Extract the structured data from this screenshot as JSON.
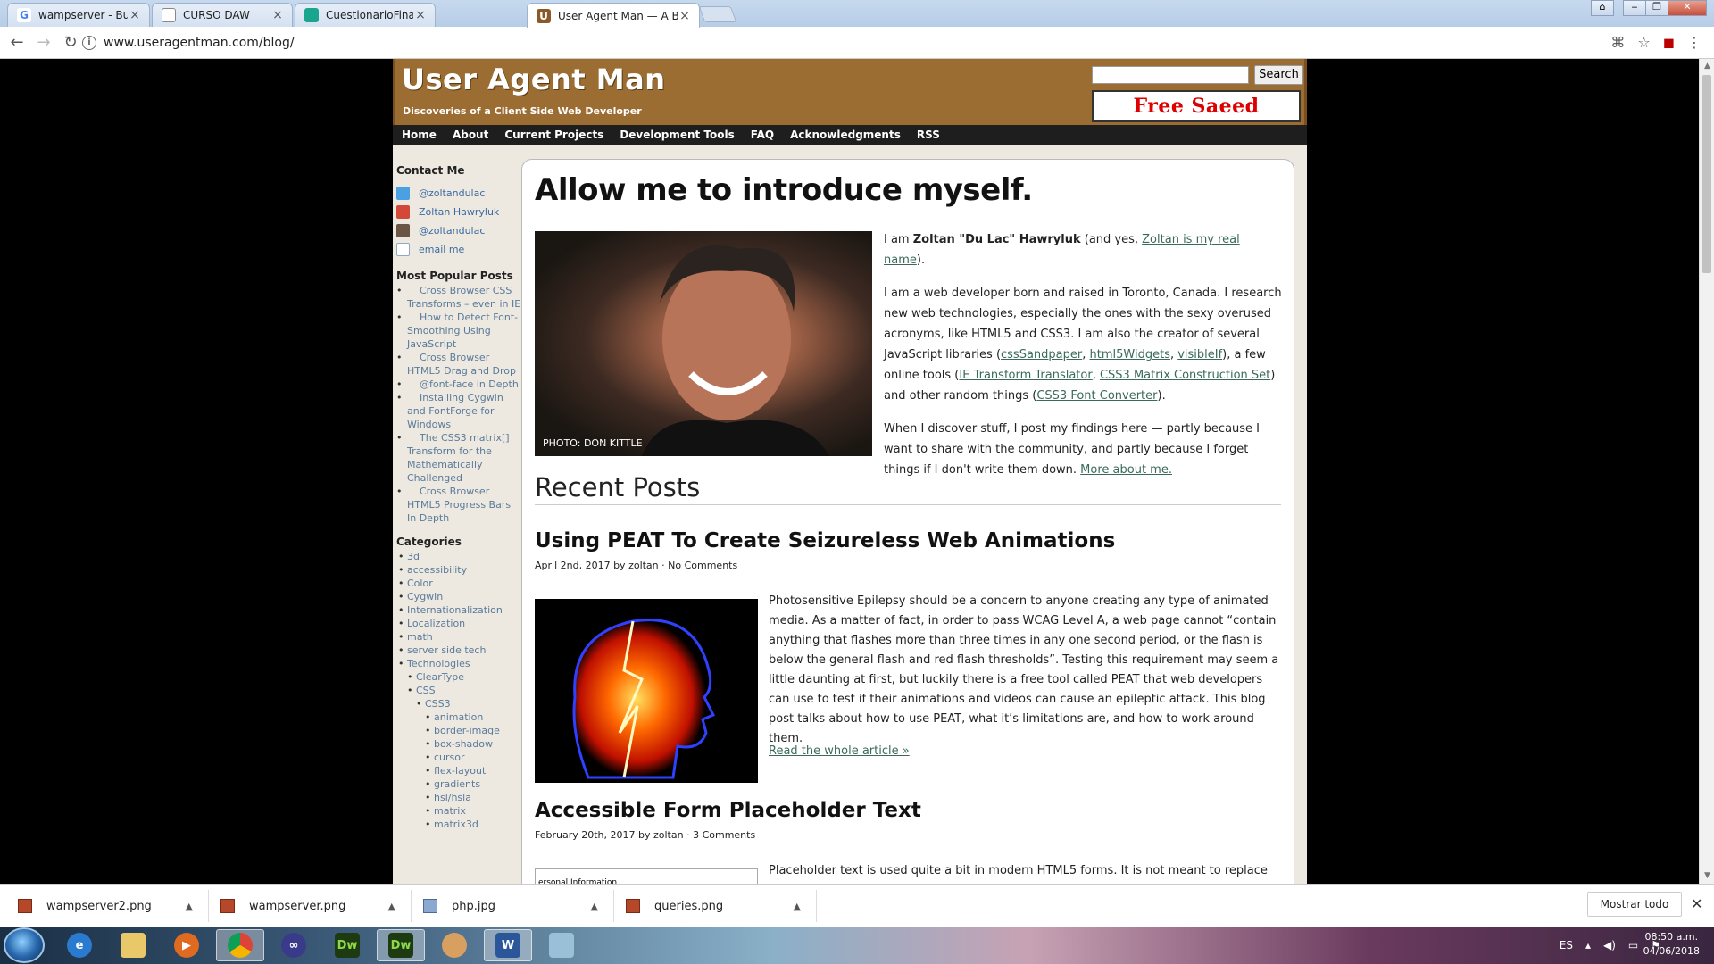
{
  "browser": {
    "tabs": [
      {
        "label": "wampserver - Buscar con",
        "fav_color": "#4285f4",
        "fav_glyph": "G"
      },
      {
        "label": "CURSO DAW",
        "fav_color": "#ffffff",
        "fav_glyph": ""
      },
      {
        "label": "CuestionarioFinal",
        "fav_color": "#1aa58f",
        "fav_glyph": ""
      },
      {
        "label": "User Agent Man — A Blo",
        "fav_color": "#8a5a28",
        "fav_glyph": "U"
      }
    ],
    "url": "www.useragentman.com/blog/"
  },
  "site": {
    "title": "User Agent Man",
    "tagline": "Discoveries of a Client Side Web Developer",
    "search_button": "Search",
    "banner": "Free Saeed Malekpour",
    "nav": [
      "Home",
      "About",
      "Current Projects",
      "Development Tools",
      "FAQ",
      "Acknowledgments",
      "RSS"
    ]
  },
  "sidebar": {
    "contact_title": "Contact Me",
    "contacts": [
      {
        "label": "@zoltandulac",
        "icon": "twitter-icon",
        "color": "#4aa0e0"
      },
      {
        "label": "Zoltan Hawryluk",
        "icon": "google-plus-icon",
        "color": "#d34836"
      },
      {
        "label": "@zoltandulac",
        "icon": "instagram-icon",
        "color": "#6b5545"
      },
      {
        "label": "email me",
        "icon": "mail-icon",
        "color": "#8fa8c8"
      }
    ],
    "popular_title": "Most Popular Posts",
    "popular": [
      "Cross Browser CSS Transforms – even in IE",
      "How to Detect Font-Smoothing Using JavaScript",
      "Cross Browser HTML5 Drag and Drop",
      "@font-face in Depth",
      "Installing Cygwin and FontForge for Windows",
      "The CSS3 matrix[] Transform for the Mathematically Challenged",
      "Cross Browser HTML5 Progress Bars In Depth"
    ],
    "categories_title": "Categories",
    "categories": [
      "3d",
      "accessibility",
      "Color",
      "Cygwin",
      "Internationalization",
      "Localization",
      "math",
      "server side tech",
      "Technologies"
    ],
    "sub1": [
      "ClearType",
      "CSS"
    ],
    "sub2": [
      "CSS3"
    ],
    "sub3": [
      "animation",
      "border-image",
      "box-shadow",
      "cursor",
      "flex-layout",
      "gradients",
      "hsl/hsla",
      "matrix",
      "matrix3d"
    ]
  },
  "main": {
    "heading": "Allow me to introduce myself.",
    "photo_caption": "PHOTO: DON KITTLE",
    "intro_p1_pre": "I am ",
    "intro_p1_name": "Zoltan \"Du Lac\" Hawryluk",
    "intro_p1_mid": " (and yes, ",
    "intro_p1_link": "Zoltan is my real name",
    "intro_p1_end": ").",
    "intro_p2_a": "I am a web developer born and raised in Toronto, Canada. I research new web technologies, especially the ones with the sexy overused acronyms, like HTML5 and CSS3. I am also the creator of several JavaScript libraries (",
    "lib1": "cssSandpaper",
    "lib2": "html5Widgets",
    "lib3": "visibleIf",
    "intro_p2_b": "), a few online tools (",
    "tool1": "IE Transform Translator",
    "tool2": "CSS3 Matrix Construction Set",
    "intro_p2_c": ") and other random things (",
    "tool3": "CSS3 Font Converter",
    "intro_p2_d": ").",
    "intro_p3": "When I discover stuff, I post my findings here — partly because I want to share with the community, and partly because I forget things if I don't write them down. ",
    "more_link": "More about me.",
    "recent_title": "Recent Posts",
    "posts": [
      {
        "title": "Using PEAT To Create Seizureless Web Animations",
        "meta": "April 2nd, 2017 by zoltan · No Comments",
        "excerpt": "Photosensitive Epilepsy should be a concern to anyone creating any type of animated media. As a matter of fact, in order to pass WCAG Level A, a web page cannot “contain anything that flashes more than three times in any one second period, or the flash is below the general flash and red flash thresholds”. Testing this requirement may seem a little daunting at first, but luckily there is a free tool called PEAT that web developers can use to test if their animations and videos can cause an epileptic attack. This blog post talks about how to use PEAT, what it’s limitations are, and how to work around them.",
        "read_more": "Read the whole article »"
      },
      {
        "title": "Accessible Form Placeholder Text",
        "meta": "February 20th, 2017 by zoltan · 3 Comments",
        "excerpt": "Placeholder text is used quite a bit in modern HTML5 forms. It is not meant to replace",
        "thumb_text": "ersonal Information"
      }
    ]
  },
  "downloads": {
    "items": [
      "wampserver2.png",
      "wampserver.png",
      "php.jpg",
      "queries.png"
    ],
    "show_all": "Mostrar todo"
  },
  "taskbar": {
    "lang": "ES",
    "time": "08:50 a.m.",
    "date": "04/06/2018"
  }
}
